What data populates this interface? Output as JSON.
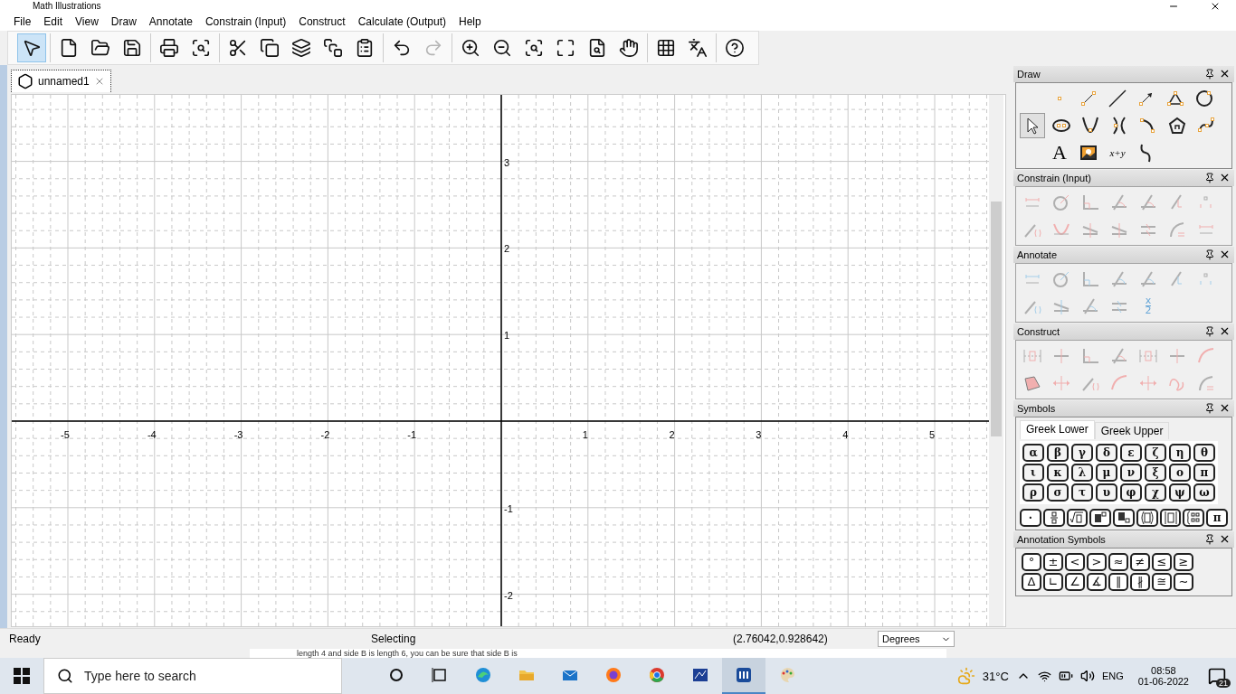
{
  "window": {
    "title": "Math Illustrations"
  },
  "menu": [
    "File",
    "Edit",
    "View",
    "Draw",
    "Annotate",
    "Constrain (Input)",
    "Construct",
    "Calculate (Output)",
    "Help"
  ],
  "toolbar": {
    "groups": [
      {
        "buttons": [
          {
            "kind": "pointer",
            "selected": true,
            "disabled": false
          }
        ]
      },
      {
        "buttons": [
          {
            "kind": "new",
            "selected": false,
            "disabled": false
          },
          {
            "kind": "open",
            "selected": false,
            "disabled": false
          },
          {
            "kind": "save",
            "selected": false,
            "disabled": false
          }
        ]
      },
      {
        "buttons": [
          {
            "kind": "print",
            "selected": false,
            "disabled": false
          },
          {
            "kind": "print-preview",
            "selected": false,
            "disabled": false
          }
        ]
      },
      {
        "buttons": [
          {
            "kind": "cut",
            "selected": false,
            "disabled": false
          },
          {
            "kind": "copy",
            "selected": false,
            "disabled": false
          },
          {
            "kind": "arrange",
            "selected": false,
            "disabled": false
          },
          {
            "kind": "group",
            "selected": false,
            "disabled": false
          },
          {
            "kind": "paste",
            "selected": false,
            "disabled": false
          }
        ]
      },
      {
        "buttons": [
          {
            "kind": "undo",
            "selected": false,
            "disabled": false
          },
          {
            "kind": "redo",
            "selected": false,
            "disabled": true
          }
        ]
      },
      {
        "buttons": [
          {
            "kind": "zoom-in",
            "selected": false,
            "disabled": false
          },
          {
            "kind": "zoom-out",
            "selected": false,
            "disabled": false
          },
          {
            "kind": "zoom-selection",
            "selected": false,
            "disabled": false
          },
          {
            "kind": "zoom-fit",
            "selected": false,
            "disabled": false
          },
          {
            "kind": "zoom-page",
            "selected": false,
            "disabled": false
          },
          {
            "kind": "pan",
            "selected": false,
            "disabled": false
          }
        ]
      },
      {
        "buttons": [
          {
            "kind": "grid",
            "selected": false,
            "disabled": false
          },
          {
            "kind": "font",
            "selected": false,
            "disabled": false
          }
        ]
      },
      {
        "buttons": [
          {
            "kind": "help",
            "selected": false,
            "disabled": false
          }
        ]
      }
    ]
  },
  "document_tab": {
    "title": "unnamed1"
  },
  "canvas": {
    "x_labels": [
      "-5",
      "-4",
      "-3",
      "-2",
      "-1",
      "1",
      "2",
      "3",
      "4",
      "5"
    ],
    "y_labels": [
      "3",
      "2",
      "1",
      "-1",
      "-2"
    ]
  },
  "dock": {
    "panels": [
      {
        "kind": "draw",
        "title": "Draw",
        "disabled": false,
        "rows": [
          [
            {
              "kind": "point",
              "selected": false
            },
            {
              "kind": "segment",
              "selected": false
            },
            {
              "kind": "line",
              "selected": false
            },
            {
              "kind": "vector",
              "selected": false
            },
            {
              "kind": "triangle",
              "selected": false
            },
            {
              "kind": "circle",
              "selected": false
            }
          ],
          [
            {
              "kind": "pointer",
              "selected": true
            },
            {
              "kind": "ellipse",
              "selected": false
            },
            {
              "kind": "parabola",
              "selected": false
            },
            {
              "kind": "hyperbola",
              "selected": false
            },
            {
              "kind": "arc",
              "selected": false
            },
            {
              "kind": "polygon",
              "selected": false
            },
            {
              "kind": "spline",
              "selected": false
            }
          ],
          [
            {
              "kind": "text",
              "label": "A",
              "selected": false
            },
            {
              "kind": "image",
              "selected": false
            },
            {
              "kind": "formula",
              "label": "x+y",
              "selected": false
            },
            {
              "kind": "curve",
              "selected": false
            }
          ]
        ]
      },
      {
        "kind": "constrain",
        "title": "Constrain (Input)",
        "disabled": true
      },
      {
        "kind": "annotate",
        "title": "Annotate",
        "disabled": true,
        "fraction": {
          "numerator": "x",
          "denominator": "2"
        }
      },
      {
        "kind": "construct",
        "title": "Construct",
        "disabled": true
      },
      {
        "kind": "symbols",
        "title": "Symbols",
        "tabs": [
          {
            "label": "Greek Lower",
            "selected": true
          },
          {
            "label": "Greek Upper",
            "selected": false
          }
        ],
        "letters": [
          "α",
          "β",
          "γ",
          "δ",
          "ε",
          "ζ",
          "η",
          "θ",
          "ι",
          "κ",
          "λ",
          "μ",
          "ν",
          "ξ",
          "ο",
          "π",
          "ρ",
          "σ",
          "τ",
          "υ",
          "φ",
          "χ",
          "ψ",
          "ω"
        ],
        "templates": [
          {
            "kind": "char",
            "label": "·"
          },
          {
            "kind": "fraction"
          },
          {
            "kind": "root"
          },
          {
            "kind": "superscript"
          },
          {
            "kind": "subscript"
          },
          {
            "kind": "parentheses"
          },
          {
            "kind": "absolute"
          },
          {
            "kind": "matrix"
          },
          {
            "kind": "char",
            "label": "π"
          }
        ]
      },
      {
        "kind": "annotation_symbols",
        "title": "Annotation Symbols",
        "symbols": [
          "°",
          "±",
          "<",
          ">",
          "≈",
          "≠",
          "≤",
          "≥",
          "Δ",
          "∟",
          "∠",
          "∡",
          "∥",
          "∦",
          "≅",
          "∼"
        ]
      }
    ]
  },
  "status_bar": {
    "message": "Ready",
    "mode": "Selecting",
    "coordinates": "(2.76042,0.928642)",
    "angle_unit": "Degrees"
  },
  "background_window": {
    "text": "length 4 and side B is length 6, you can be sure that side B is"
  },
  "taskbar": {
    "search_placeholder": "Type here to search",
    "apps": [
      {
        "kind": "cortana",
        "active": false
      },
      {
        "kind": "task-view",
        "active": false
      },
      {
        "kind": "browser-wave",
        "active": false
      },
      {
        "kind": "folder",
        "active": false
      },
      {
        "kind": "mail",
        "active": false
      },
      {
        "kind": "fox-browser",
        "active": false
      },
      {
        "kind": "round-browser",
        "active": false
      },
      {
        "kind": "chart-app",
        "active": false
      },
      {
        "kind": "math-app",
        "active": true
      },
      {
        "kind": "palette",
        "active": false
      }
    ],
    "weather": "31°C",
    "language": "ENG",
    "time": "08:58",
    "date": "01-06-2022",
    "notifications": "21"
  }
}
